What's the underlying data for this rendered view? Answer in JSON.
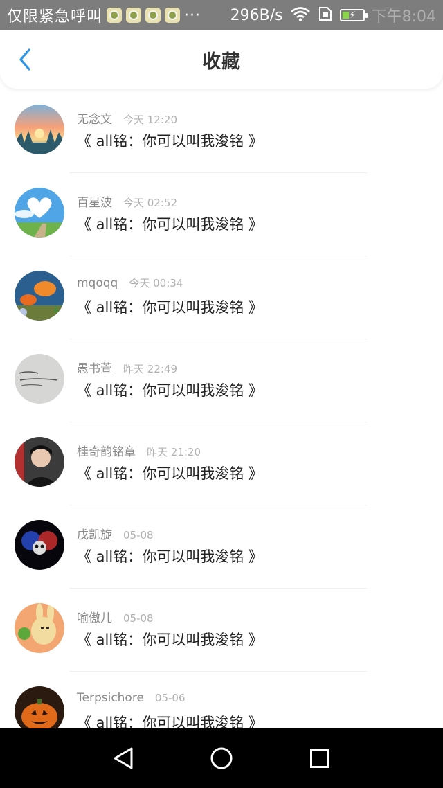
{
  "status_bar": {
    "carrier_text": "仅限紧急呼叫",
    "overflow": "···",
    "speed": "296B/s",
    "time": "下午8:04",
    "icons": [
      "app-notification-icon",
      "app-notification-icon",
      "app-notification-icon",
      "app-notification-icon",
      "wifi-icon",
      "sim-icon",
      "battery-charging-icon"
    ]
  },
  "header": {
    "title": "收藏",
    "back_icon": "chevron-left-icon",
    "accent": "#2b95e9"
  },
  "items": [
    {
      "name": "无念文",
      "time": "今天 12:20",
      "message": "《 all铭：你可以叫我浚铭 》",
      "avatar": "sunset-landscape"
    },
    {
      "name": "百星波",
      "time": "今天 02:52",
      "message": "《 all铭：你可以叫我浚铭 》",
      "avatar": "heart-cloud-sky"
    },
    {
      "name": "mqoqq",
      "time": "今天 00:34",
      "message": "《 all铭：你可以叫我浚铭 》",
      "avatar": "aquarium-fish"
    },
    {
      "name": "愚书萱",
      "time": "昨天 22:49",
      "message": "《 all铭：你可以叫我浚铭 》",
      "avatar": "handwriting-paper"
    },
    {
      "name": "桂奇韵铭章",
      "time": "昨天 21:20",
      "message": "《 all铭：你可以叫我浚铭 》",
      "avatar": "person-photo"
    },
    {
      "name": "戊凯旋",
      "time": "05-08",
      "message": "《 all铭：你可以叫我浚铭 》",
      "avatar": "dark-skull-art"
    },
    {
      "name": "喻傲儿",
      "time": "05-08",
      "message": "《 all铭：你可以叫我浚铭 》",
      "avatar": "cartoon-rabbit"
    },
    {
      "name": "Terpsichore",
      "time": "05-06",
      "message": "《 all铭：你可以叫我浚铭 》",
      "avatar": "pumpkin-lantern"
    }
  ],
  "nav_bar": {
    "back": "triangle-back-icon",
    "home": "circle-home-icon",
    "recents": "square-recents-icon"
  }
}
